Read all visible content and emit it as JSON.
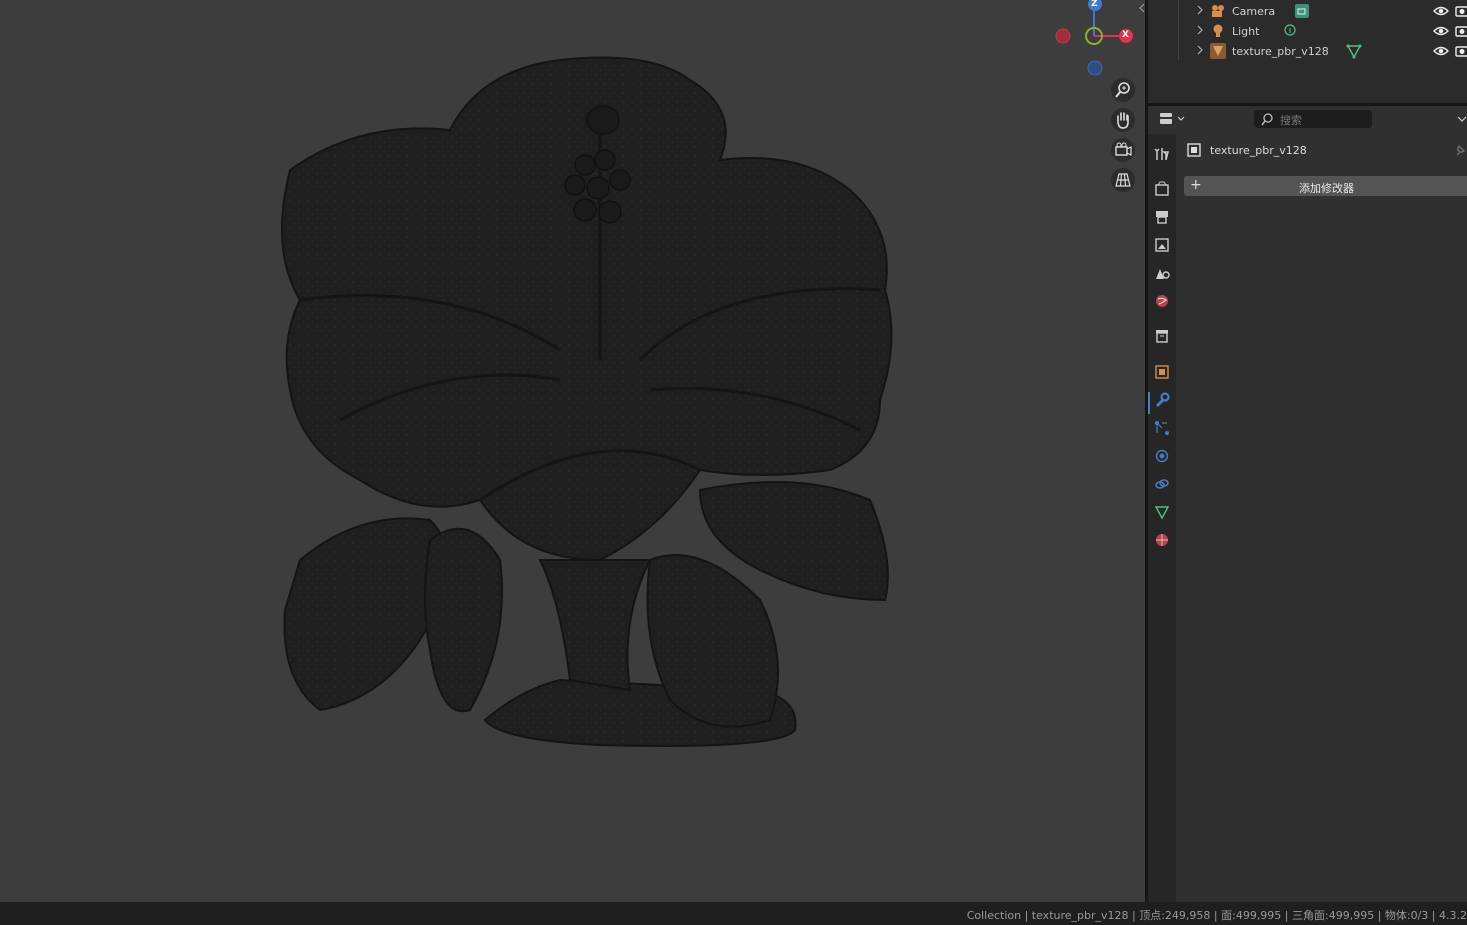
{
  "outliner": {
    "rows": [
      {
        "label": "Camera",
        "icon": "camera-object-icon",
        "extra_icon": "camera-data-icon"
      },
      {
        "label": "Light",
        "icon": "light-object-icon",
        "extra_icon": "light-data-icon"
      },
      {
        "label": "texture_pbr_v128",
        "icon": "mesh-object-icon",
        "extra_icon": "mesh-data-icon"
      }
    ]
  },
  "properties": {
    "search_placeholder": "搜索",
    "object_name": "texture_pbr_v128",
    "add_modifier_label": "添加修改器",
    "tabs": [
      "tool-tab",
      "render-tab",
      "output-tab",
      "view-layer-tab",
      "scene-tab",
      "world-tab",
      "collection-tab",
      "object-tab",
      "modifier-tab",
      "particles-tab",
      "physics-tab",
      "constraints-tab",
      "data-tab",
      "material-tab"
    ],
    "active_tab": "modifier-tab"
  },
  "gizmo": {
    "z_label": "Z",
    "x_label": "X"
  },
  "statusbar": {
    "text": "Collection | texture_pbr_v128 | 顶点:249,958 | 面:499,995 | 三角面:499,995 | 物体:0/3 | 4.3.2"
  },
  "colors": {
    "accent": "#4b7bc4",
    "axis_x": "#e0334f",
    "axis_y": "#8bb42c",
    "axis_z": "#3d7bd1"
  }
}
